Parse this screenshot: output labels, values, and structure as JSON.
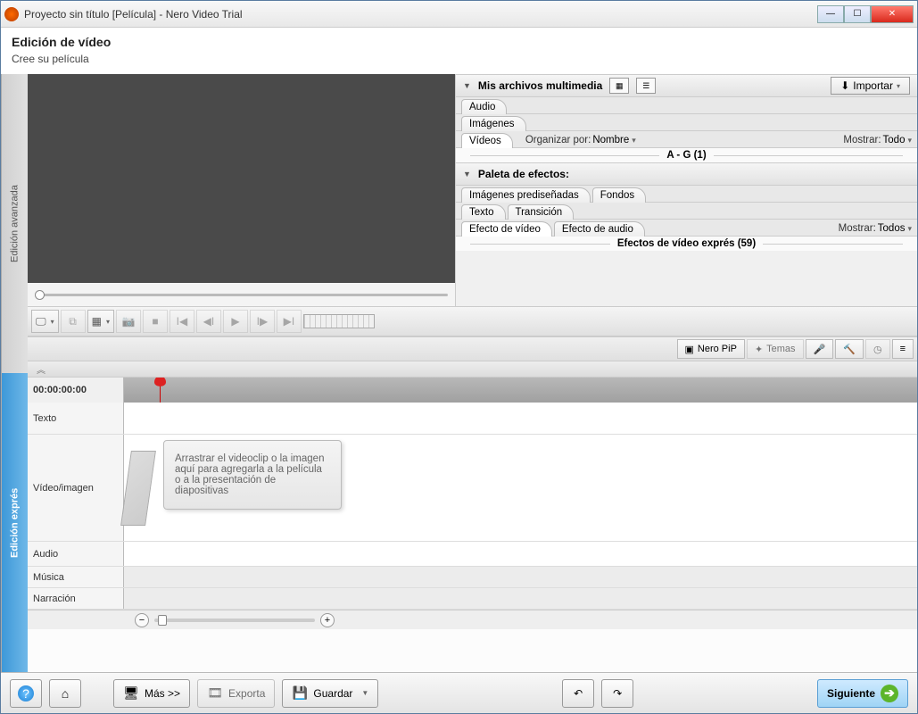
{
  "window": {
    "title": "Proyecto sin título [Película] - Nero Video Trial"
  },
  "header": {
    "title": "Edición de vídeo",
    "subtitle": "Cree su película"
  },
  "side_tabs": {
    "advanced": "Edición avanzada",
    "express": "Edición exprés"
  },
  "media_panel": {
    "title": "Mis archivos multimedia",
    "import": "Importar",
    "tabs": {
      "audio": "Audio",
      "images": "Imágenes",
      "videos": "Vídeos"
    },
    "organize_label": "Organizar por:",
    "organize_value": "Nombre",
    "show_label": "Mostrar:",
    "show_value": "Todo",
    "group": "A - G (1)"
  },
  "effects_panel": {
    "title": "Paleta de efectos:",
    "tabs": {
      "clipart": "Imágenes prediseñadas",
      "backgrounds": "Fondos",
      "text": "Texto",
      "transition": "Transición",
      "video_fx": "Efecto de vídeo",
      "audio_fx": "Efecto de audio"
    },
    "show_label": "Mostrar:",
    "show_value": "Todos",
    "group": "Efectos de vídeo exprés (59)"
  },
  "right_toolbar": {
    "pip": "Nero PiP",
    "themes": "Temas"
  },
  "timeline": {
    "timecode": "00:00:00:00",
    "tracks": {
      "text": "Texto",
      "video": "Vídeo/imagen",
      "audio": "Audio",
      "music": "Música",
      "narration": "Narración"
    },
    "drop_hint": "Arrastrar el videoclip o la imagen aquí para agregarla a la película o a la presentación de diapositivas"
  },
  "footer": {
    "more": "Más >>",
    "export": "Exporta",
    "save": "Guardar",
    "next": "Siguiente"
  }
}
